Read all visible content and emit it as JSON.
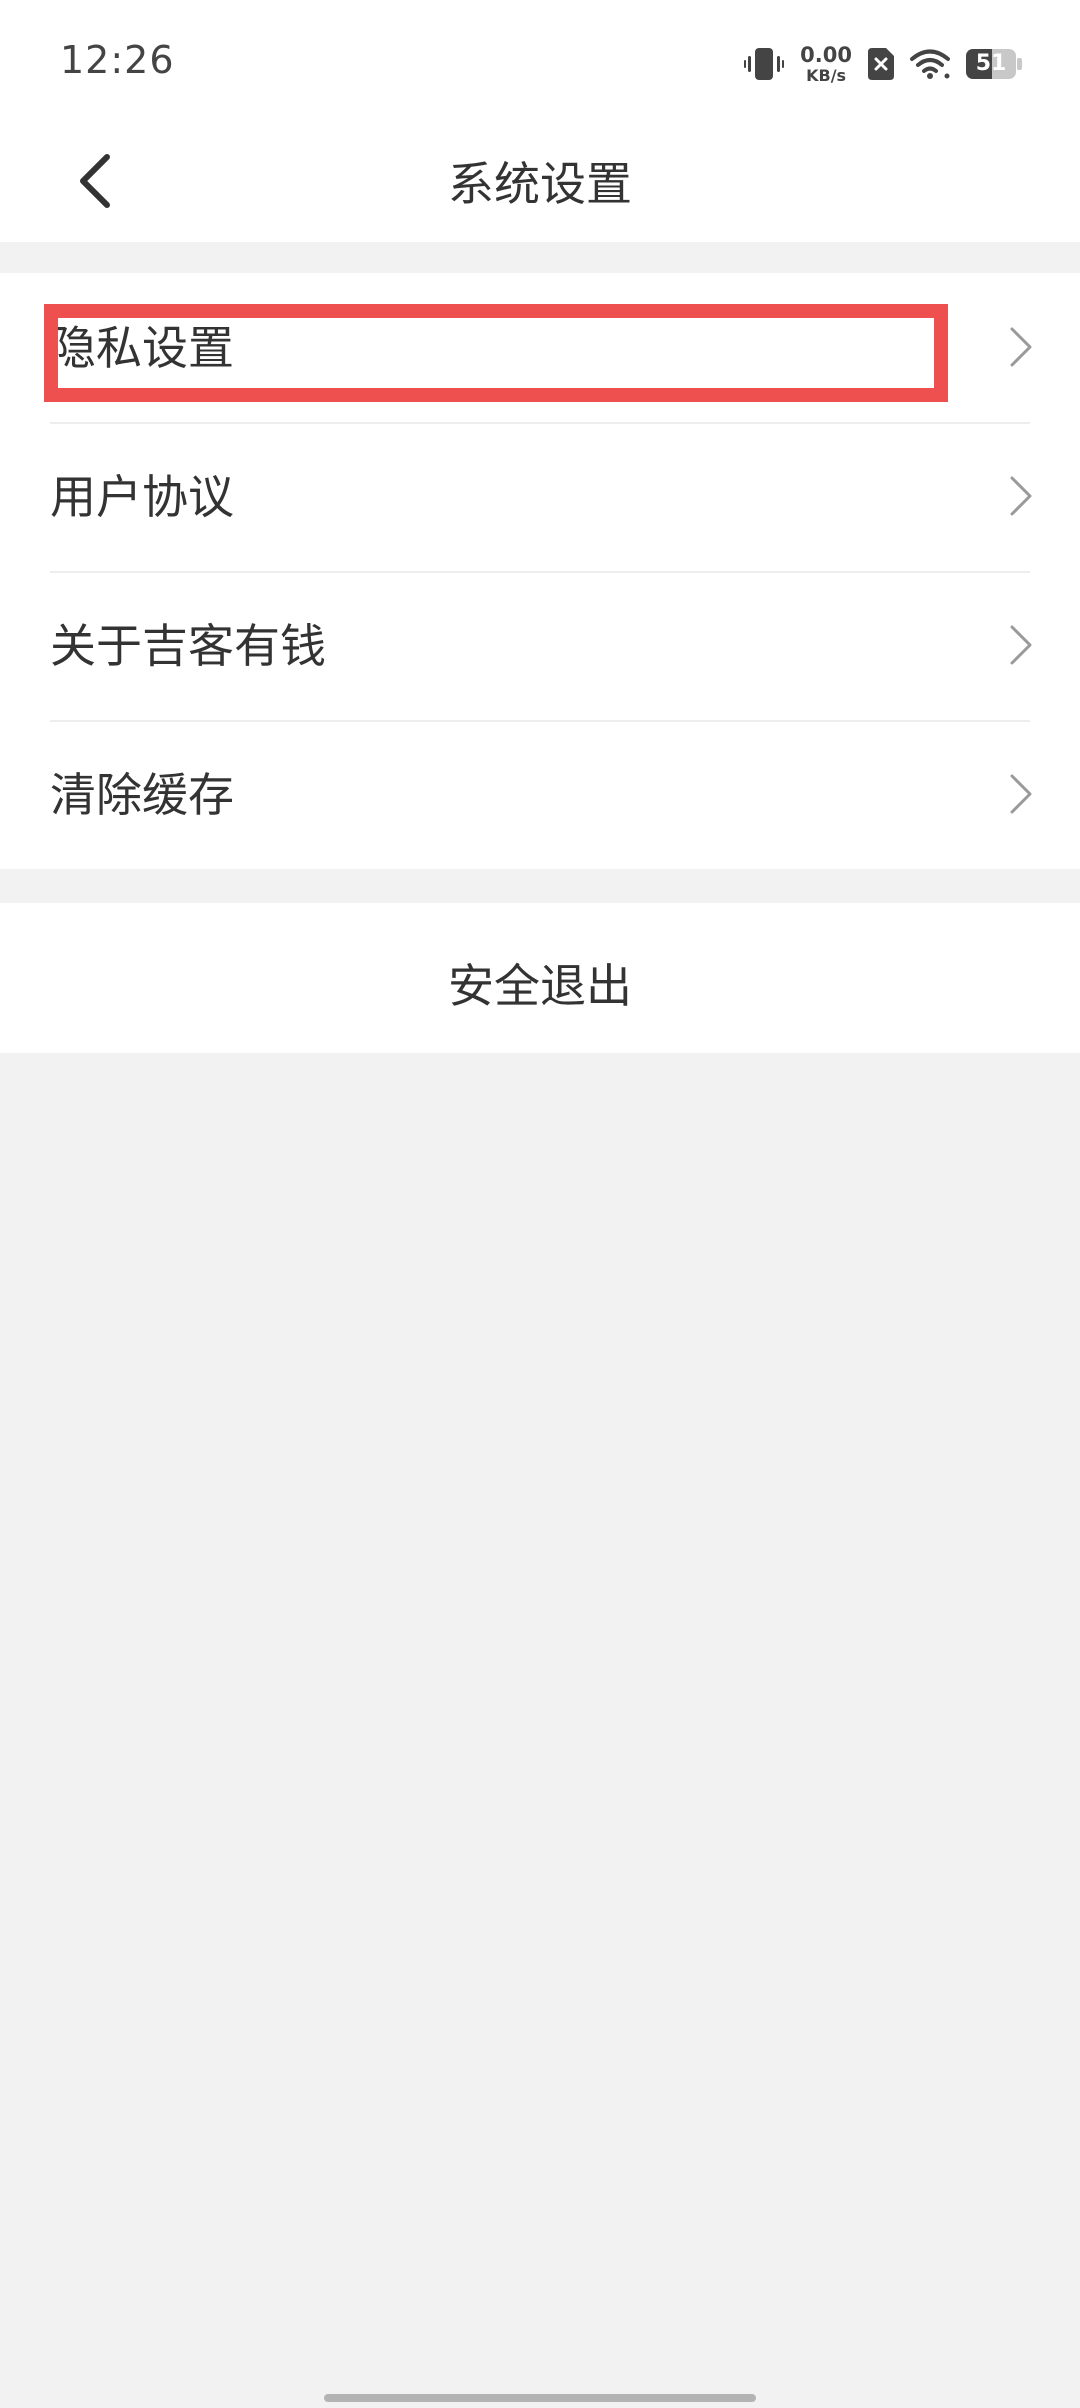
{
  "status_bar": {
    "time": "12:26",
    "net_speed_value": "0.00",
    "net_speed_unit": "KB/s",
    "battery_level": "51",
    "icons": [
      "vibrate-icon",
      "sim-off-icon",
      "wifi-icon",
      "battery-icon"
    ]
  },
  "header": {
    "title": "系统设置",
    "back_icon": "chevron-left-icon"
  },
  "menu": {
    "items": [
      {
        "label": "隐私设置",
        "icon": "chevron-right-icon",
        "highlighted": true
      },
      {
        "label": "用户协议",
        "icon": "chevron-right-icon"
      },
      {
        "label": "关于吉客有钱",
        "icon": "chevron-right-icon"
      },
      {
        "label": "清除缓存",
        "icon": "chevron-right-icon"
      }
    ]
  },
  "logout": {
    "label": "安全退出"
  },
  "colors": {
    "background": "#f2f2f2",
    "surface": "#ffffff",
    "text": "#333333",
    "highlight": "#ee5050",
    "chevron": "#9a9a9a"
  }
}
